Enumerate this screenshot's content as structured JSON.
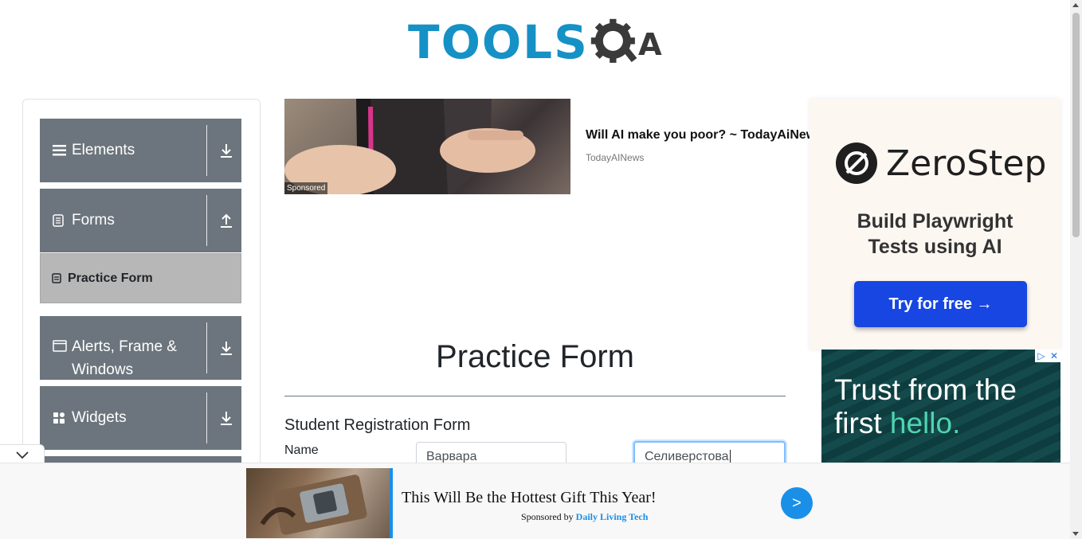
{
  "header": {
    "logo_text": "TOOLS",
    "logo_suffix": "A"
  },
  "sidebar": {
    "groups": [
      {
        "label": "Elements",
        "icon": "hamburger-icon",
        "toggle": "down-arrow-icon"
      },
      {
        "label": "Forms",
        "icon": "document-icon",
        "toggle": "up-arrow-icon"
      },
      {
        "label": "Alerts, Frame & Windows",
        "icon": "window-icon",
        "toggle": "down-arrow-icon"
      },
      {
        "label": "Widgets",
        "icon": "widgets-icon",
        "toggle": "down-arrow-icon"
      }
    ],
    "active_item": "Practice Form"
  },
  "top_ad": {
    "title": "Will AI make you poor? ~ TodayAiNews",
    "source": "TodayAINews",
    "badge": "Sponsored"
  },
  "right_ad": {
    "brand": "ZeroStep",
    "tagline_1": "Build Playwright",
    "tagline_2": "Tests using AI",
    "cta": "Try for free →"
  },
  "trust_ad": {
    "line1": "Trust from the",
    "line2a": "first ",
    "line2b": "hello."
  },
  "main": {
    "title": "Practice Form",
    "subtitle": "Student Registration Form",
    "name_label": "Name",
    "first_name": "Варвара",
    "last_name": "Селиверстова"
  },
  "bottom_ad": {
    "headline": "This Will Be the Hottest Gift This Year!",
    "sponsored_by": "Sponsored by ",
    "brand": "Daily Living Tech",
    "go": ">"
  },
  "colors": {
    "sidebar_group": "#6c757d",
    "active_item": "#b7b7b7",
    "logo_blue": "#1591c6",
    "cta_blue": "#1746e2"
  }
}
